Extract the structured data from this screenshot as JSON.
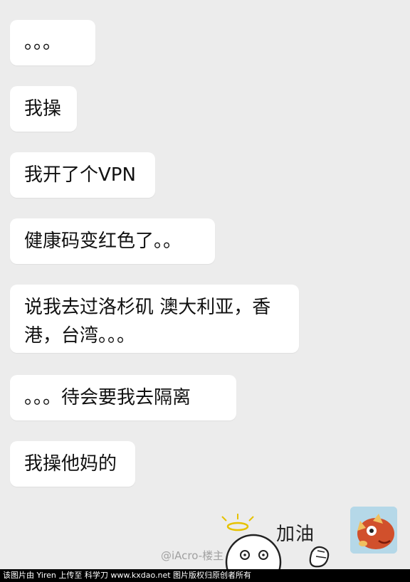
{
  "messages": [
    "。。。",
    "我操",
    "我开了个VPN",
    "健康码变红色了。。",
    "说我去过洛杉矶 澳大利亚，香\n港，台湾。。。",
    "。。。待会要我去隔离",
    "我操他妈的"
  ],
  "sticker": {
    "text": "加油"
  },
  "watermark": "@iAcro-楼主",
  "footer": "该图片由 Yiren 上传至 科学刀 www.kxdao.net 图片版权归原创者所有",
  "colors": {
    "background": "#ececec",
    "bubble": "#ffffff",
    "footer": "#000000"
  }
}
